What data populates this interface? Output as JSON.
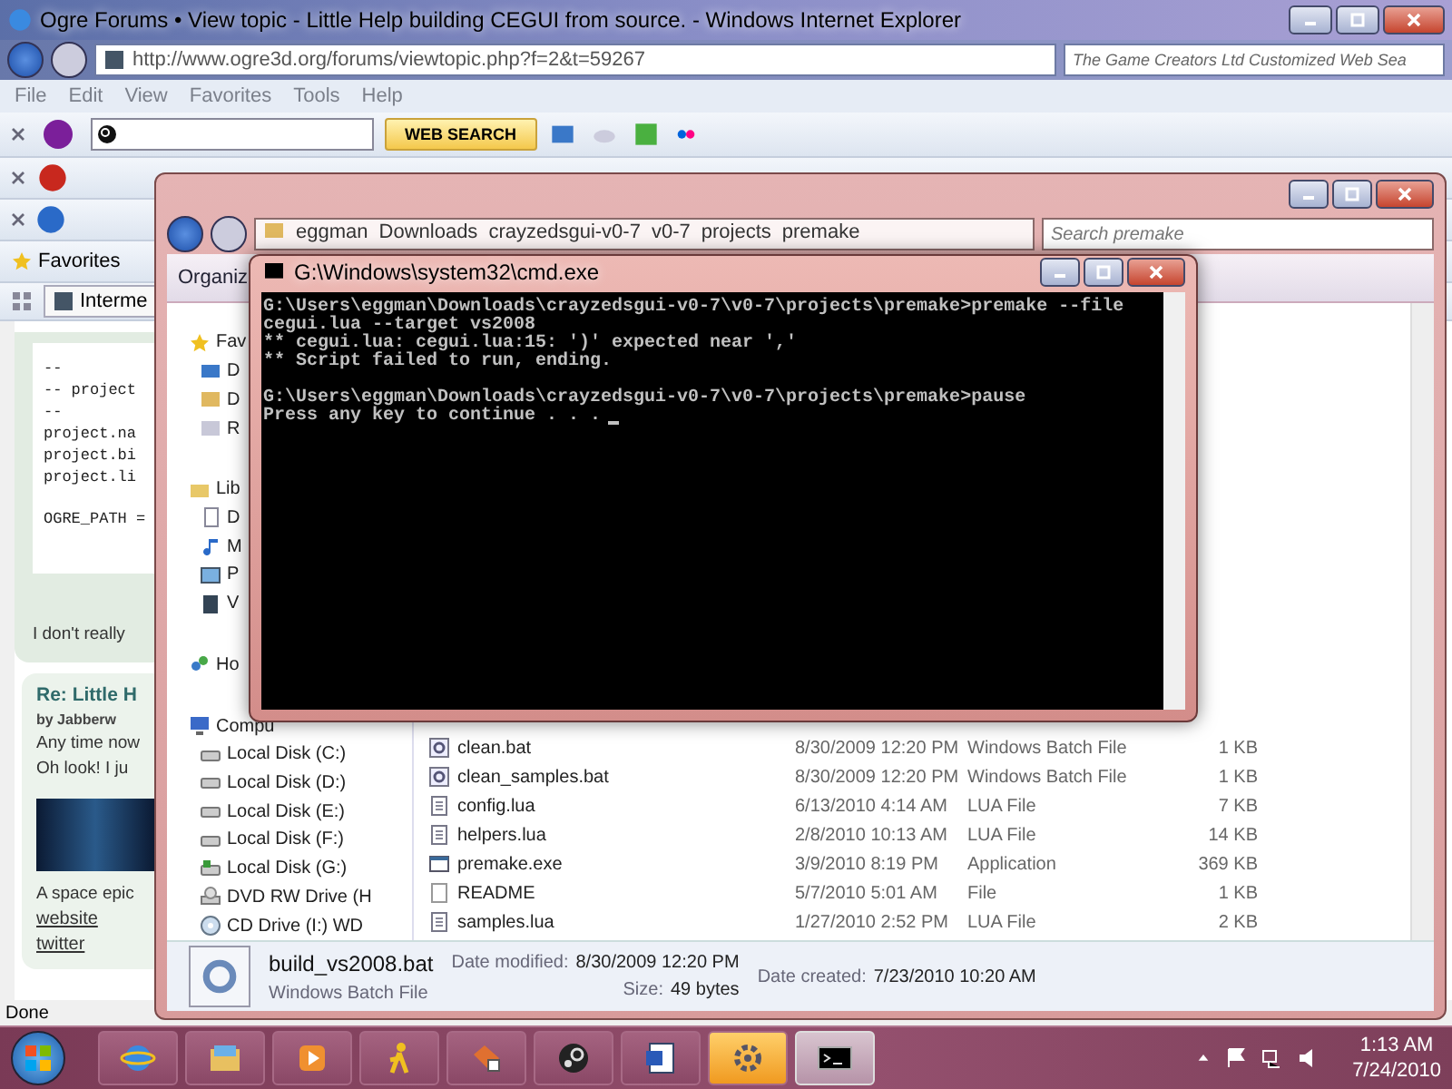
{
  "ie": {
    "title": "Ogre Forums • View topic - Little Help building CEGUI from source. - Windows Internet Explorer",
    "address": "http://www.ogre3d.org/forums/viewtopic.php?f=2&t=59267",
    "search_placeholder": "The Game Creators Ltd Customized Web Sea",
    "menu": [
      "File",
      "Edit",
      "View",
      "Favorites",
      "Tools",
      "Help"
    ],
    "web_search": "WEB SEARCH",
    "favorites": "Favorites",
    "tab": "Interme",
    "page": {
      "code_blocks": [
        [
          "--",
          "-- project",
          "--",
          "project.na",
          "project.bi",
          "project.li"
        ],
        [
          "OGRE_PATH ="
        ]
      ],
      "post_text": "I don't really",
      "reply": {
        "title": "Re: Little H",
        "author": "by Jabberw",
        "lines": [
          "Any time now",
          "Oh look! I ju"
        ],
        "caption": "A space epic",
        "links": [
          "website",
          "twitter"
        ]
      }
    },
    "status": "Done"
  },
  "explorer": {
    "breadcrumb": [
      "eggman",
      "Downloads",
      "crayzedsgui-v0-7",
      "v0-7",
      "projects",
      "premake"
    ],
    "search_placeholder": "Search premake",
    "organize": "Organiz",
    "nav": [
      {
        "label": "Fav",
        "kind": "favorites"
      },
      {
        "label": "D",
        "kind": "desktop"
      },
      {
        "label": "D",
        "kind": "downloads"
      },
      {
        "label": "R",
        "kind": "recent"
      },
      {
        "label": "Lib",
        "kind": "libraries"
      },
      {
        "label": "D",
        "kind": "documents"
      },
      {
        "label": "M",
        "kind": "music"
      },
      {
        "label": "P",
        "kind": "pictures"
      },
      {
        "label": "V",
        "kind": "videos"
      },
      {
        "label": "Ho",
        "kind": "homegroup"
      },
      {
        "label": "Compu",
        "kind": "computer"
      },
      {
        "label": "Local Disk (C:)",
        "kind": "disk"
      },
      {
        "label": "Local Disk (D:)",
        "kind": "disk"
      },
      {
        "label": "Local Disk (E:)",
        "kind": "disk"
      },
      {
        "label": "Local Disk (F:)",
        "kind": "disk"
      },
      {
        "label": "Local Disk (G:)",
        "kind": "system-disk"
      },
      {
        "label": "DVD RW Drive (H",
        "kind": "dvd"
      },
      {
        "label": "CD Drive (I:) WD",
        "kind": "cd"
      }
    ],
    "files": [
      {
        "name": "clean.bat",
        "date": "8/30/2009 12:20 PM",
        "type": "Windows Batch File",
        "size": "1 KB",
        "kind": "batch"
      },
      {
        "name": "clean_samples.bat",
        "date": "8/30/2009 12:20 PM",
        "type": "Windows Batch File",
        "size": "1 KB",
        "kind": "batch"
      },
      {
        "name": "config.lua",
        "date": "6/13/2010 4:14 AM",
        "type": "LUA File",
        "size": "7 KB",
        "kind": "text"
      },
      {
        "name": "helpers.lua",
        "date": "2/8/2010 10:13 AM",
        "type": "LUA File",
        "size": "14 KB",
        "kind": "text"
      },
      {
        "name": "premake.exe",
        "date": "3/9/2010 8:19 PM",
        "type": "Application",
        "size": "369 KB",
        "kind": "app"
      },
      {
        "name": "README",
        "date": "5/7/2010 5:01 AM",
        "type": "File",
        "size": "1 KB",
        "kind": "blank"
      },
      {
        "name": "samples.lua",
        "date": "1/27/2010 2:52 PM",
        "type": "LUA File",
        "size": "2 KB",
        "kind": "text"
      }
    ],
    "details": {
      "name": "build_vs2008.bat",
      "type": "Windows Batch File",
      "columns": [
        [
          {
            "label": "Date modified:",
            "value": "8/30/2009 12:20 PM"
          },
          {
            "label": "Size:",
            "value": "49 bytes"
          }
        ],
        [
          {
            "label": "Date created:",
            "value": "7/23/2010 10:20 AM"
          }
        ]
      ]
    }
  },
  "cmd": {
    "title": "G:\\Windows\\system32\\cmd.exe",
    "blocks": [
      [
        "G:\\Users\\eggman\\Downloads\\crayzedsgui-v0-7\\v0-7\\projects\\premake>premake --file",
        "cegui.lua --target vs2008",
        "** cegui.lua: cegui.lua:15: ')' expected near ','",
        "** Script failed to run, ending."
      ],
      [
        "G:\\Users\\eggman\\Downloads\\crayzedsgui-v0-7\\v0-7\\projects\\premake>pause",
        "Press any key to continue . . ."
      ]
    ]
  },
  "taskbar": {
    "apps": [
      {
        "kind": "browser",
        "selected": false,
        "highlighted": false
      },
      {
        "kind": "folder",
        "selected": false,
        "highlighted": false
      },
      {
        "kind": "media",
        "selected": false,
        "highlighted": false
      },
      {
        "kind": "runner",
        "selected": false,
        "highlighted": false
      },
      {
        "kind": "puzzle",
        "selected": false,
        "highlighted": false
      },
      {
        "kind": "steam",
        "selected": false,
        "highlighted": false
      },
      {
        "kind": "word",
        "selected": false,
        "highlighted": false
      },
      {
        "kind": "gear",
        "selected": false,
        "highlighted": true
      },
      {
        "kind": "terminal",
        "selected": true,
        "highlighted": false
      }
    ],
    "time": "1:13 AM",
    "date": "7/24/2010"
  }
}
